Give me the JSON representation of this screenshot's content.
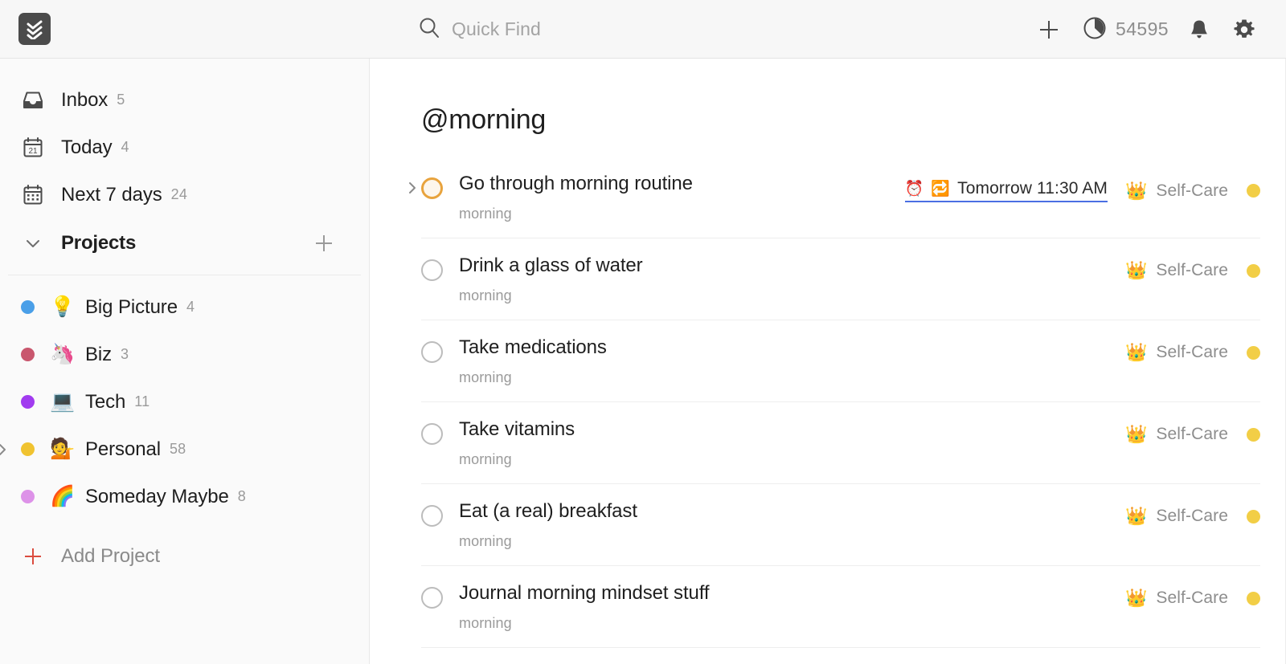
{
  "header": {
    "logo_name": "todoist-logo",
    "search": {
      "placeholder": "Quick Find",
      "value": ""
    },
    "add_label": "+",
    "karma": {
      "value": "54595",
      "icon": "karma-pie-icon"
    },
    "notifications_icon": "bell-icon",
    "settings_icon": "gear-icon"
  },
  "sidebar": {
    "nav": [
      {
        "label": "Inbox",
        "count": "5",
        "icon": "inbox-icon"
      },
      {
        "label": "Today",
        "count": "4",
        "icon": "calendar-day-icon",
        "day": "21"
      },
      {
        "label": "Next 7 days",
        "count": "24",
        "icon": "calendar-week-icon"
      }
    ],
    "projects_section": {
      "title": "Projects",
      "chevron_icon": "chevron-down-icon",
      "add_icon": "plus-icon"
    },
    "projects": [
      {
        "name": "Big Picture",
        "count": "4",
        "emoji": "💡",
        "color": "#4a9fe8",
        "expandable": false
      },
      {
        "name": "Biz",
        "count": "3",
        "emoji": "🦄",
        "color": "#c9576e",
        "expandable": false
      },
      {
        "name": "Tech",
        "count": "11",
        "emoji": "💻",
        "color": "#a13bef",
        "expandable": false
      },
      {
        "name": "Personal",
        "count": "58",
        "emoji": "💁",
        "color": "#f0c330",
        "expandable": true
      },
      {
        "name": "Someday Maybe",
        "count": "8",
        "emoji": "🌈",
        "color": "#dd92e8",
        "expandable": false
      }
    ],
    "add_project": {
      "label": "Add Project",
      "icon": "plus-icon",
      "color": "#db4c3f"
    }
  },
  "main": {
    "page_title": "@morning",
    "tasks": [
      {
        "title": "Go through morning routine",
        "sub": "morning",
        "priority": "p3",
        "expandable": true,
        "due": {
          "text": "Tomorrow 11:30 AM",
          "alarm_icon": "⏰",
          "recurring_icon": "🔁",
          "underline_color": "#4a6fe3"
        },
        "project": {
          "emoji": "👑",
          "label": "Self-Care",
          "color": "#f2ce46"
        }
      },
      {
        "title": "Drink a glass of water",
        "sub": "morning",
        "priority": "none",
        "expandable": false,
        "due": null,
        "project": {
          "emoji": "👑",
          "label": "Self-Care",
          "color": "#f2ce46"
        }
      },
      {
        "title": "Take medications",
        "sub": "morning",
        "priority": "none",
        "expandable": false,
        "due": null,
        "project": {
          "emoji": "👑",
          "label": "Self-Care",
          "color": "#f2ce46"
        }
      },
      {
        "title": "Take vitamins",
        "sub": "morning",
        "priority": "none",
        "expandable": false,
        "due": null,
        "project": {
          "emoji": "👑",
          "label": "Self-Care",
          "color": "#f2ce46"
        }
      },
      {
        "title": "Eat (a real) breakfast",
        "sub": "morning",
        "priority": "none",
        "expandable": false,
        "due": null,
        "project": {
          "emoji": "👑",
          "label": "Self-Care",
          "color": "#f2ce46"
        }
      },
      {
        "title": "Journal morning mindset stuff",
        "sub": "morning",
        "priority": "none",
        "expandable": false,
        "due": null,
        "project": {
          "emoji": "👑",
          "label": "Self-Care",
          "color": "#f2ce46"
        }
      }
    ]
  }
}
